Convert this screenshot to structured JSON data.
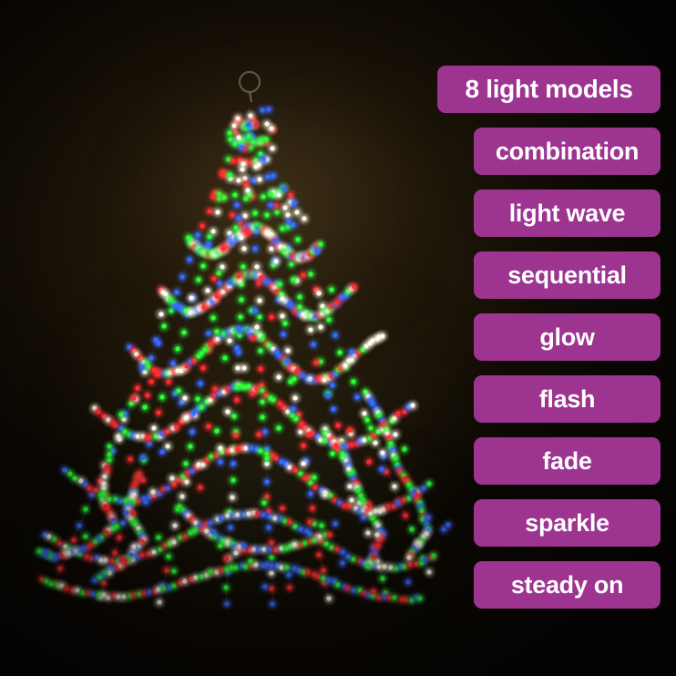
{
  "background": {
    "base_color": "#1d1508",
    "description": "dark warm brown photographic backdrop"
  },
  "product": {
    "name": "led-christmas-tree-light",
    "hook_label": "hanging-ring",
    "led_colors": [
      "#ff2d32",
      "#2dff3c",
      "#3a6bff",
      "#fffdf2"
    ],
    "led_color_names": [
      "red",
      "green",
      "blue",
      "white"
    ]
  },
  "labels": {
    "accent_color": "#9c3490",
    "text_color": "#ffffff",
    "items": [
      {
        "label": "8 light models",
        "wide": true
      },
      {
        "label": "combination",
        "wide": false
      },
      {
        "label": "light wave",
        "wide": false
      },
      {
        "label": "sequential",
        "wide": false
      },
      {
        "label": "glow",
        "wide": false
      },
      {
        "label": "flash",
        "wide": false
      },
      {
        "label": "fade",
        "wide": false
      },
      {
        "label": "sparkle",
        "wide": false
      },
      {
        "label": "steady on",
        "wide": false
      }
    ]
  }
}
